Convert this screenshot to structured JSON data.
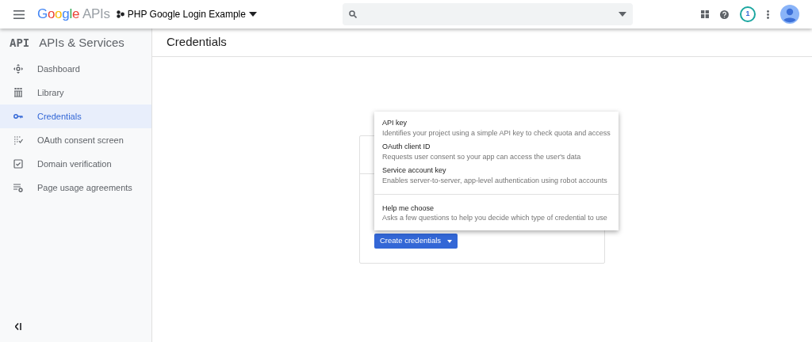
{
  "header": {
    "logo_brand": "Google",
    "logo_product": "APIs",
    "project": "PHP Google Login Example",
    "notification_count": "1"
  },
  "sidebar": {
    "logo": "API",
    "title": "APIs & Services",
    "items": [
      {
        "label": "Dashboard",
        "selected": false
      },
      {
        "label": "Library",
        "selected": false
      },
      {
        "label": "Credentials",
        "selected": true
      },
      {
        "label": "OAuth consent screen",
        "selected": false
      },
      {
        "label": "Domain verification",
        "selected": false
      },
      {
        "label": "Page usage agreements",
        "selected": false
      }
    ]
  },
  "page": {
    "title": "Credentials"
  },
  "create_button": {
    "label": "Create credentials"
  },
  "menu": {
    "groups": [
      [
        {
          "title": "API key",
          "description": "Identifies your project using a simple API key to check quota and access"
        },
        {
          "title": "OAuth client ID",
          "description": "Requests user consent so your app can access the user's data"
        },
        {
          "title": "Service account key",
          "description": "Enables server-to-server, app-level authentication using robot accounts"
        }
      ],
      [
        {
          "title": "Help me choose",
          "description": "Asks a few questions to help you decide which type of credential to use"
        }
      ]
    ]
  }
}
